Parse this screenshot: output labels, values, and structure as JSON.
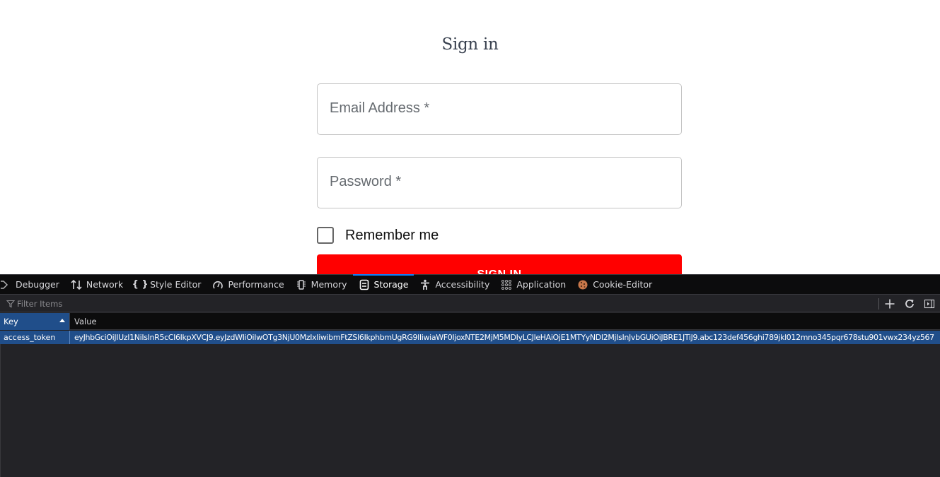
{
  "page": {
    "title": "Sign in",
    "email_label": "Email Address *",
    "password_label": "Password *",
    "remember_label": "Remember me",
    "remember_checked": false,
    "submit_label": "SIGN IN",
    "accent_color": "#ff0000"
  },
  "devtools": {
    "tabs": [
      {
        "label": "Debugger",
        "icon": "debugger-icon"
      },
      {
        "label": "Network",
        "icon": "network-icon"
      },
      {
        "label": "Style Editor",
        "icon": "style-editor-icon"
      },
      {
        "label": "Performance",
        "icon": "performance-icon"
      },
      {
        "label": "Memory",
        "icon": "memory-icon"
      },
      {
        "label": "Storage",
        "icon": "storage-icon",
        "selected": true
      },
      {
        "label": "Accessibility",
        "icon": "accessibility-icon"
      },
      {
        "label": "Application",
        "icon": "application-icon"
      },
      {
        "label": "Cookie-Editor",
        "icon": "cookie-icon"
      }
    ],
    "filter": {
      "placeholder": "Filter Items",
      "value": ""
    },
    "toolbar_buttons": [
      {
        "name": "add-item",
        "icon": "plus-icon"
      },
      {
        "name": "refresh",
        "icon": "refresh-icon"
      },
      {
        "name": "toggle-sidebar",
        "icon": "sidebar-toggle-icon"
      }
    ],
    "table": {
      "columns": [
        "Key",
        "Value"
      ],
      "sorted_by": "Key",
      "sort_direction": "ascending",
      "rows": [
        {
          "key": "access_token",
          "value": "eyJhbGciOiJIUzI1NiIsInR5cCI6IkpXVCJ9.eyJzdWIiOiIwOTg3NjU0MzIxIiwibmFtZSI6IkphbmUgRG9lIiwiaWF0IjoxNTE2MjM5MDIyLCJleHAiOjE1MTYyNDI2MjIsInJvbGUiOiJBRE1JTiJ9.abc123def456ghi789jkl012mno345pqr678stu901vwx234yz567",
          "selected": true
        }
      ]
    },
    "colors": {
      "selected_tab_indicator": "#0a84ff",
      "selected_row": "#204e8a",
      "panel_bg": "#232327",
      "toolbar_bg": "#0c0c0d"
    }
  }
}
